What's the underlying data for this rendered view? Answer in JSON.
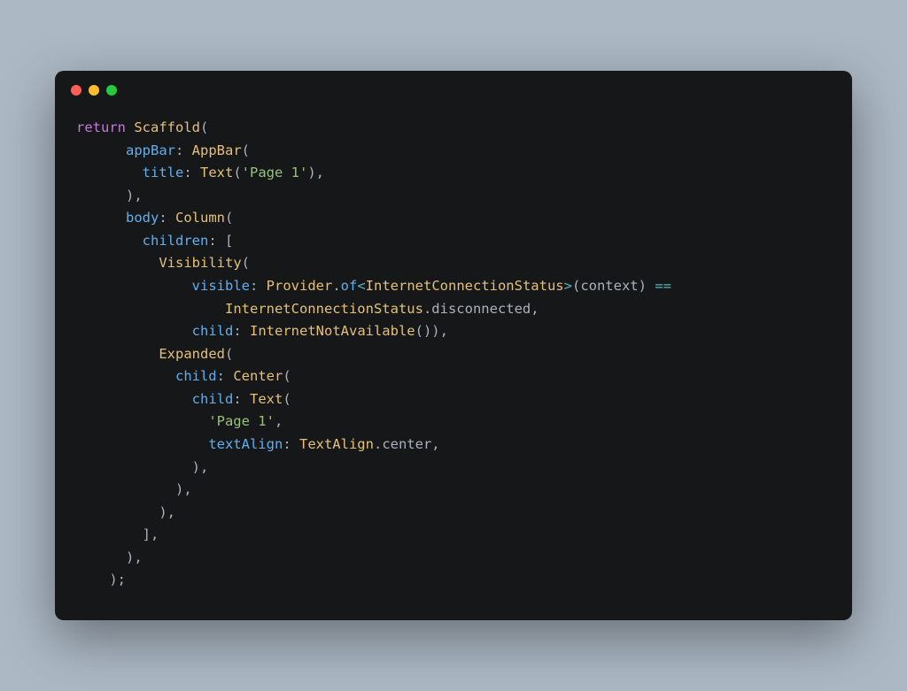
{
  "titlebar": {
    "buttons": [
      "close",
      "minimize",
      "maximize"
    ]
  },
  "code": {
    "tokens": [
      [
        {
          "t": "return",
          "c": "kw"
        },
        {
          "t": " ",
          "c": "punct"
        },
        {
          "t": "Scaffold",
          "c": "cls"
        },
        {
          "t": "(",
          "c": "paren"
        }
      ],
      [
        {
          "t": "      ",
          "c": "punct"
        },
        {
          "t": "appBar",
          "c": "prop"
        },
        {
          "t": ": ",
          "c": "punct"
        },
        {
          "t": "AppBar",
          "c": "cls"
        },
        {
          "t": "(",
          "c": "paren"
        }
      ],
      [
        {
          "t": "        ",
          "c": "punct"
        },
        {
          "t": "title",
          "c": "prop"
        },
        {
          "t": ": ",
          "c": "punct"
        },
        {
          "t": "Text",
          "c": "cls"
        },
        {
          "t": "(",
          "c": "paren"
        },
        {
          "t": "'Page 1'",
          "c": "str"
        },
        {
          "t": "),",
          "c": "paren"
        }
      ],
      [
        {
          "t": "      ),",
          "c": "paren"
        }
      ],
      [
        {
          "t": "      ",
          "c": "punct"
        },
        {
          "t": "body",
          "c": "prop"
        },
        {
          "t": ": ",
          "c": "punct"
        },
        {
          "t": "Column",
          "c": "cls"
        },
        {
          "t": "(",
          "c": "paren"
        }
      ],
      [
        {
          "t": "        ",
          "c": "punct"
        },
        {
          "t": "children",
          "c": "prop"
        },
        {
          "t": ": [",
          "c": "punct"
        }
      ],
      [
        {
          "t": "          ",
          "c": "punct"
        },
        {
          "t": "Visibility",
          "c": "cls"
        },
        {
          "t": "(",
          "c": "paren"
        }
      ],
      [
        {
          "t": "              ",
          "c": "punct"
        },
        {
          "t": "visible",
          "c": "prop"
        },
        {
          "t": ": ",
          "c": "punct"
        },
        {
          "t": "Provider",
          "c": "cls"
        },
        {
          "t": ".",
          "c": "punct"
        },
        {
          "t": "of",
          "c": "prop"
        },
        {
          "t": "<",
          "c": "op"
        },
        {
          "t": "InternetConnectionStatus",
          "c": "cls"
        },
        {
          "t": ">",
          "c": "op"
        },
        {
          "t": "(context) ",
          "c": "punct"
        },
        {
          "t": "==",
          "c": "op"
        }
      ],
      [
        {
          "t": "                  ",
          "c": "punct"
        },
        {
          "t": "InternetConnectionStatus",
          "c": "cls"
        },
        {
          "t": ".disconnected,",
          "c": "punct"
        }
      ],
      [
        {
          "t": "              ",
          "c": "punct"
        },
        {
          "t": "child",
          "c": "prop"
        },
        {
          "t": ": ",
          "c": "punct"
        },
        {
          "t": "InternetNotAvailable",
          "c": "cls"
        },
        {
          "t": "()),",
          "c": "paren"
        }
      ],
      [
        {
          "t": "          ",
          "c": "punct"
        },
        {
          "t": "Expanded",
          "c": "cls"
        },
        {
          "t": "(",
          "c": "paren"
        }
      ],
      [
        {
          "t": "            ",
          "c": "punct"
        },
        {
          "t": "child",
          "c": "prop"
        },
        {
          "t": ": ",
          "c": "punct"
        },
        {
          "t": "Center",
          "c": "cls"
        },
        {
          "t": "(",
          "c": "paren"
        }
      ],
      [
        {
          "t": "              ",
          "c": "punct"
        },
        {
          "t": "child",
          "c": "prop"
        },
        {
          "t": ": ",
          "c": "punct"
        },
        {
          "t": "Text",
          "c": "cls"
        },
        {
          "t": "(",
          "c": "paren"
        }
      ],
      [
        {
          "t": "                ",
          "c": "punct"
        },
        {
          "t": "'Page 1'",
          "c": "str"
        },
        {
          "t": ",",
          "c": "punct"
        }
      ],
      [
        {
          "t": "                ",
          "c": "punct"
        },
        {
          "t": "textAlign",
          "c": "prop"
        },
        {
          "t": ": ",
          "c": "punct"
        },
        {
          "t": "TextAlign",
          "c": "cls"
        },
        {
          "t": ".center,",
          "c": "punct"
        }
      ],
      [
        {
          "t": "              ),",
          "c": "paren"
        }
      ],
      [
        {
          "t": "            ),",
          "c": "paren"
        }
      ],
      [
        {
          "t": "          ),",
          "c": "paren"
        }
      ],
      [
        {
          "t": "        ],",
          "c": "punct"
        }
      ],
      [
        {
          "t": "      ),",
          "c": "paren"
        }
      ],
      [
        {
          "t": "    );",
          "c": "paren"
        }
      ]
    ]
  }
}
